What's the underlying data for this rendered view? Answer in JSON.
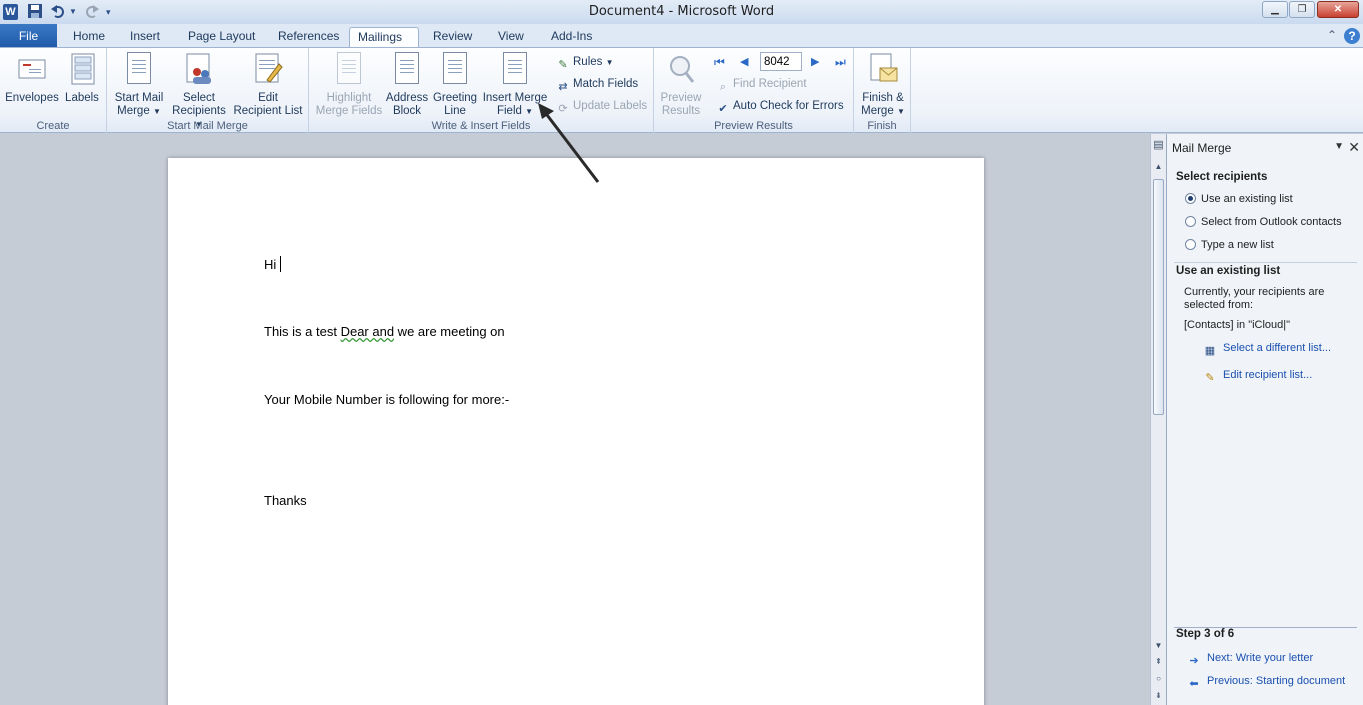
{
  "titlebar": {
    "app_icon_letter": "W",
    "title": "Document4  -  Microsoft Word",
    "qat_icons": [
      "save-icon",
      "undo-icon",
      "redo-icon",
      "customize-icon"
    ],
    "window_controls": [
      "minimize",
      "maximize",
      "close"
    ]
  },
  "tabs": {
    "file": "File",
    "items": [
      "Home",
      "Insert",
      "Page Layout",
      "References",
      "Mailings",
      "Review",
      "View",
      "Add-Ins"
    ],
    "active": "Mailings"
  },
  "ribbon": {
    "groups": {
      "create": {
        "label": "Create",
        "envelopes": "Envelopes",
        "labels": "Labels"
      },
      "start_mail_merge": {
        "label": "Start Mail Merge",
        "start_line1": "Start Mail",
        "start_line2": "Merge",
        "select_line1": "Select",
        "select_line2": "Recipients",
        "edit_line1": "Edit",
        "edit_line2": "Recipient List"
      },
      "write_insert": {
        "label": "Write & Insert Fields",
        "highlight_line1": "Highlight",
        "highlight_line2": "Merge Fields",
        "address_line1": "Address",
        "address_line2": "Block",
        "greeting_line1": "Greeting",
        "greeting_line2": "Line",
        "insert_line1": "Insert Merge",
        "insert_line2": "Field",
        "rules": "Rules",
        "match_fields": "Match Fields",
        "update_labels": "Update Labels"
      },
      "preview": {
        "label": "Preview Results",
        "preview_line1": "Preview",
        "preview_line2": "Results",
        "record_number": "8042",
        "find_recipient": "Find Recipient",
        "auto_check": "Auto Check for Errors"
      },
      "finish": {
        "label": "Finish",
        "finish_line1": "Finish &",
        "finish_line2": "Merge"
      }
    }
  },
  "document": {
    "line1": "Hi",
    "line2_prefix": "This is a test ",
    "line2_field": "Dear  and",
    "line2_suffix": " we are meeting on",
    "line3": "Your Mobile Number is following for more:-",
    "line4": "Thanks"
  },
  "pane": {
    "title": "Mail Merge",
    "select_recipients_heading": "Select recipients",
    "options": [
      "Use an existing list",
      "Select from Outlook contacts",
      "Type a new list"
    ],
    "selected_option": 0,
    "existing_list_heading": "Use an existing list",
    "currently_text_1": "Currently, your recipients are",
    "currently_text_2": "selected from:",
    "source_text": "[Contacts] in \"iCloud|\"",
    "select_different_link": "Select a different list...",
    "edit_recipient_link": "Edit recipient list...",
    "step_text": "Step 3 of 6",
    "next_link": "Next: Write your letter",
    "previous_link": "Previous: Starting document"
  }
}
